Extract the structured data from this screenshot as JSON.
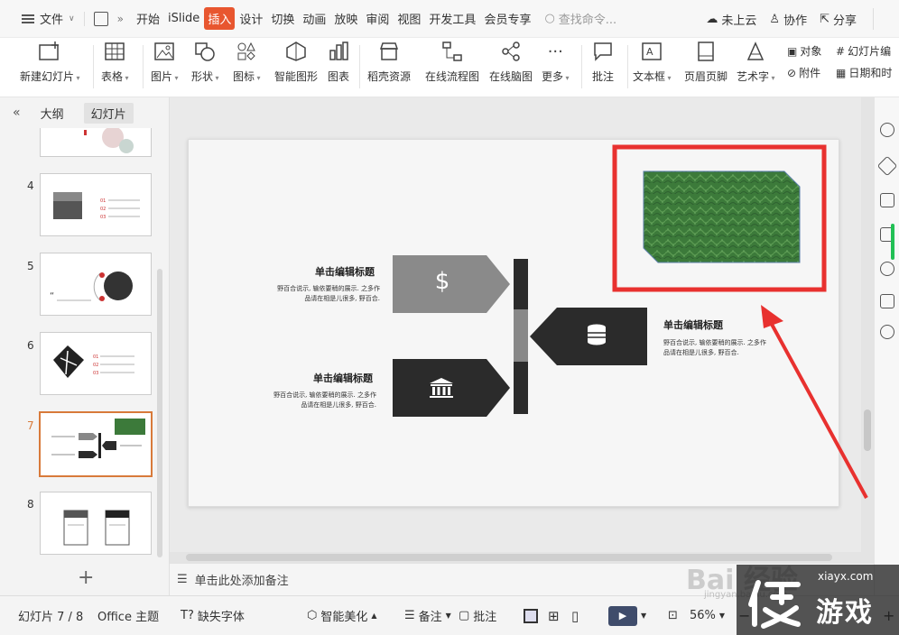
{
  "menubar": {
    "file_label": "文件",
    "items": [
      "开始",
      "iSlide",
      "插入",
      "设计",
      "切换",
      "动画",
      "放映",
      "审阅",
      "视图",
      "开发工具",
      "会员专享"
    ],
    "active_index": 2,
    "search_placeholder": "查找命令...",
    "cloud_label": "未上云",
    "collab_label": "协作",
    "share_label": "分享"
  },
  "ribbon": {
    "new_slide": "新建幻灯片",
    "table": "表格",
    "picture": "图片",
    "shape": "形状",
    "icon": "图标",
    "smart_graphic": "智能图形",
    "chart": "图表",
    "resource": "稻壳资源",
    "flowchart": "在线流程图",
    "mindmap": "在线脑图",
    "more": "更多",
    "comment": "批注",
    "textbox": "文本框",
    "header_footer": "页眉页脚",
    "wordart": "艺术字",
    "object": "对象",
    "attachment": "附件",
    "slide_number": "幻灯片编",
    "datetime": "日期和时"
  },
  "leftpanel": {
    "tab_outline": "大纲",
    "tab_slides": "幻灯片",
    "slide_numbers": [
      "4",
      "5",
      "6",
      "7",
      "8"
    ],
    "selected": "7"
  },
  "slide": {
    "title_1": "单击编辑标题",
    "body_1a": "野百合说示, 输依要稍的展示. 之多作",
    "body_1b": "品请在相是儿很多, 野百合.",
    "title_2": "单击编辑标题",
    "body_2a": "野百合说示, 输依要稍的展示. 之多作",
    "body_2b": "品请在相是儿很多, 野百合.",
    "title_3": "单击编辑标题",
    "body_3a": "野百合说示, 输依要稍的展示. 之多作",
    "body_3b": "品请在相是儿很多, 野百合.",
    "dollar": "$"
  },
  "notes": {
    "placeholder": "单击此处添加备注"
  },
  "statusbar": {
    "slide_indicator": "幻灯片 7 / 8",
    "theme": "Office 主题",
    "missing_font": "缺失字体",
    "smart_beautify": "智能美化",
    "notes": "备注",
    "comment": "批注",
    "zoom": "56%"
  },
  "watermark": {
    "site": "xiayx.com",
    "brand": "游戏",
    "baidu": "Bai 经验",
    "sub": "jingyan.baidu.com"
  },
  "colors": {
    "accent": "#e8562f",
    "highlight": "#e8312f",
    "green_texture": "#3c7a3a",
    "dark": "#2b2b2b",
    "grey": "#8a8a8a"
  }
}
